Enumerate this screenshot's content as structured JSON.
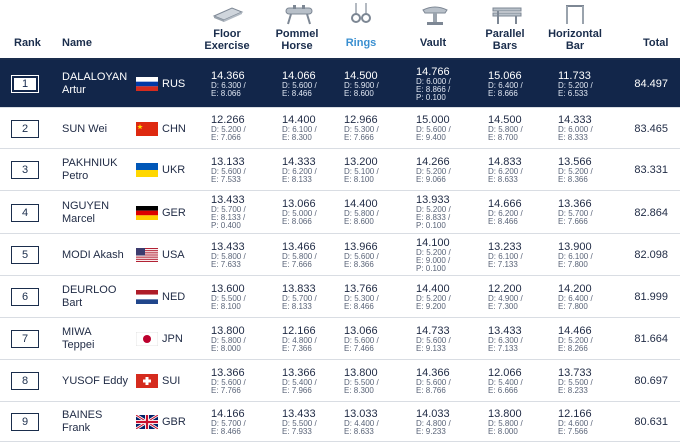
{
  "header": {
    "rank": "Rank",
    "name": "Name",
    "floor": [
      "Floor",
      "Exercise"
    ],
    "pommel": [
      "Pommel",
      "Horse"
    ],
    "rings": "Rings",
    "vault": "Vault",
    "parallel": [
      "Parallel",
      "Bars"
    ],
    "horizontal": [
      "Horizontal",
      "Bar"
    ],
    "total": "Total"
  },
  "rows": [
    {
      "rank": "1",
      "name1": "DALALOYAN",
      "name2": "Artur",
      "nation": "RUS",
      "flag": "rus",
      "scores": [
        [
          "14.366",
          "D: 6.300 /",
          "E: 8.066",
          ""
        ],
        [
          "14.066",
          "D: 5.600 /",
          "E: 8.466",
          ""
        ],
        [
          "14.500",
          "D: 5.900 /",
          "E: 8.600",
          ""
        ],
        [
          "14.766",
          "D: 6.000 /",
          "E: 8.866 /",
          "P: 0.100"
        ],
        [
          "15.066",
          "D: 6.400 /",
          "E: 8.666",
          ""
        ],
        [
          "11.733",
          "D: 5.200 /",
          "E: 6.533",
          ""
        ]
      ],
      "total": "84.497"
    },
    {
      "rank": "2",
      "name1": "SUN Wei",
      "name2": "",
      "nation": "CHN",
      "flag": "chn",
      "scores": [
        [
          "12.266",
          "D: 5.200 /",
          "E: 7.066",
          ""
        ],
        [
          "14.400",
          "D: 6.100 /",
          "E: 8.300",
          ""
        ],
        [
          "12.966",
          "D: 5.300 /",
          "E: 7.666",
          ""
        ],
        [
          "15.000",
          "D: 5.600 /",
          "E: 9.400",
          ""
        ],
        [
          "14.500",
          "D: 5.800 /",
          "E: 8.700",
          ""
        ],
        [
          "14.333",
          "D: 6.000 /",
          "E: 8.333",
          ""
        ]
      ],
      "total": "83.465"
    },
    {
      "rank": "3",
      "name1": "PAKHNIUK",
      "name2": "Petro",
      "nation": "UKR",
      "flag": "ukr",
      "scores": [
        [
          "13.133",
          "D: 5.600 /",
          "E: 7.533",
          ""
        ],
        [
          "14.333",
          "D: 6.200 /",
          "E: 8.133",
          ""
        ],
        [
          "13.200",
          "D: 5.100 /",
          "E: 8.100",
          ""
        ],
        [
          "14.266",
          "D: 5.200 /",
          "E: 9.066",
          ""
        ],
        [
          "14.833",
          "D: 6.200 /",
          "E: 8.633",
          ""
        ],
        [
          "13.566",
          "D: 5.200 /",
          "E: 8.366",
          ""
        ]
      ],
      "total": "83.331"
    },
    {
      "rank": "4",
      "name1": "NGUYEN",
      "name2": "Marcel",
      "nation": "GER",
      "flag": "ger",
      "scores": [
        [
          "13.433",
          "D: 5.700 /",
          "E: 8.133 /",
          "P: 0.400"
        ],
        [
          "13.066",
          "D: 5.000 /",
          "E: 8.066",
          ""
        ],
        [
          "14.400",
          "D: 5.800 /",
          "E: 8.600",
          ""
        ],
        [
          "13.933",
          "D: 5.200 /",
          "E: 8.833 /",
          "P: 0.100"
        ],
        [
          "14.666",
          "D: 6.200 /",
          "E: 8.466",
          ""
        ],
        [
          "13.366",
          "D: 5.700 /",
          "E: 7.666",
          ""
        ]
      ],
      "total": "82.864"
    },
    {
      "rank": "5",
      "name1": "MODI Akash",
      "name2": "",
      "nation": "USA",
      "flag": "usa",
      "scores": [
        [
          "13.433",
          "D: 5.800 /",
          "E: 7.633",
          ""
        ],
        [
          "13.466",
          "D: 5.800 /",
          "E: 7.666",
          ""
        ],
        [
          "13.966",
          "D: 5.600 /",
          "E: 8.366",
          ""
        ],
        [
          "14.100",
          "D: 5.200 /",
          "E: 9.000 /",
          "P: 0.100"
        ],
        [
          "13.233",
          "D: 6.100 /",
          "E: 7.133",
          ""
        ],
        [
          "13.900",
          "D: 6.100 /",
          "E: 7.800",
          ""
        ]
      ],
      "total": "82.098"
    },
    {
      "rank": "6",
      "name1": "DEURLOO",
      "name2": "Bart",
      "nation": "NED",
      "flag": "ned",
      "scores": [
        [
          "13.600",
          "D: 5.500 /",
          "E: 8.100",
          ""
        ],
        [
          "13.833",
          "D: 5.700 /",
          "E: 8.133",
          ""
        ],
        [
          "13.766",
          "D: 5.300 /",
          "E: 8.466",
          ""
        ],
        [
          "14.400",
          "D: 5.200 /",
          "E: 9.200",
          ""
        ],
        [
          "12.200",
          "D: 4.900 /",
          "E: 7.300",
          ""
        ],
        [
          "14.200",
          "D: 6.400 /",
          "E: 7.800",
          ""
        ]
      ],
      "total": "81.999"
    },
    {
      "rank": "7",
      "name1": "MIWA",
      "name2": "Teppei",
      "nation": "JPN",
      "flag": "jpn",
      "scores": [
        [
          "13.800",
          "D: 5.800 /",
          "E: 8.000",
          ""
        ],
        [
          "12.166",
          "D: 4.800 /",
          "E: 7.366",
          ""
        ],
        [
          "13.066",
          "D: 5.600 /",
          "E: 7.466",
          ""
        ],
        [
          "14.733",
          "D: 5.600 /",
          "E: 9.133",
          ""
        ],
        [
          "13.433",
          "D: 6.300 /",
          "E: 7.133",
          ""
        ],
        [
          "14.466",
          "D: 5.200 /",
          "E: 8.266",
          ""
        ]
      ],
      "total": "81.664"
    },
    {
      "rank": "8",
      "name1": "YUSOF Eddy",
      "name2": "",
      "nation": "SUI",
      "flag": "sui",
      "scores": [
        [
          "13.366",
          "D: 5.600 /",
          "E: 7.766",
          ""
        ],
        [
          "13.366",
          "D: 5.400 /",
          "E: 7.966",
          ""
        ],
        [
          "13.800",
          "D: 5.500 /",
          "E: 8.300",
          ""
        ],
        [
          "14.366",
          "D: 5.600 /",
          "E: 8.766",
          ""
        ],
        [
          "12.066",
          "D: 5.400 /",
          "E: 6.666",
          ""
        ],
        [
          "13.733",
          "D: 5.500 /",
          "E: 8.233",
          ""
        ]
      ],
      "total": "80.697"
    },
    {
      "rank": "9",
      "name1": "BAINES",
      "name2": "Frank",
      "nation": "GBR",
      "flag": "gbr",
      "scores": [
        [
          "14.166",
          "D: 5.700 /",
          "E: 8.466",
          ""
        ],
        [
          "13.433",
          "D: 5.500 /",
          "E: 7.933",
          ""
        ],
        [
          "13.033",
          "D: 4.400 /",
          "E: 8.633",
          ""
        ],
        [
          "14.033",
          "D: 4.800 /",
          "E: 9.233",
          ""
        ],
        [
          "13.800",
          "D: 5.800 /",
          "E: 8.000",
          ""
        ],
        [
          "12.166",
          "D: 4.600 /",
          "E: 7.566",
          ""
        ]
      ],
      "total": "80.631"
    }
  ]
}
